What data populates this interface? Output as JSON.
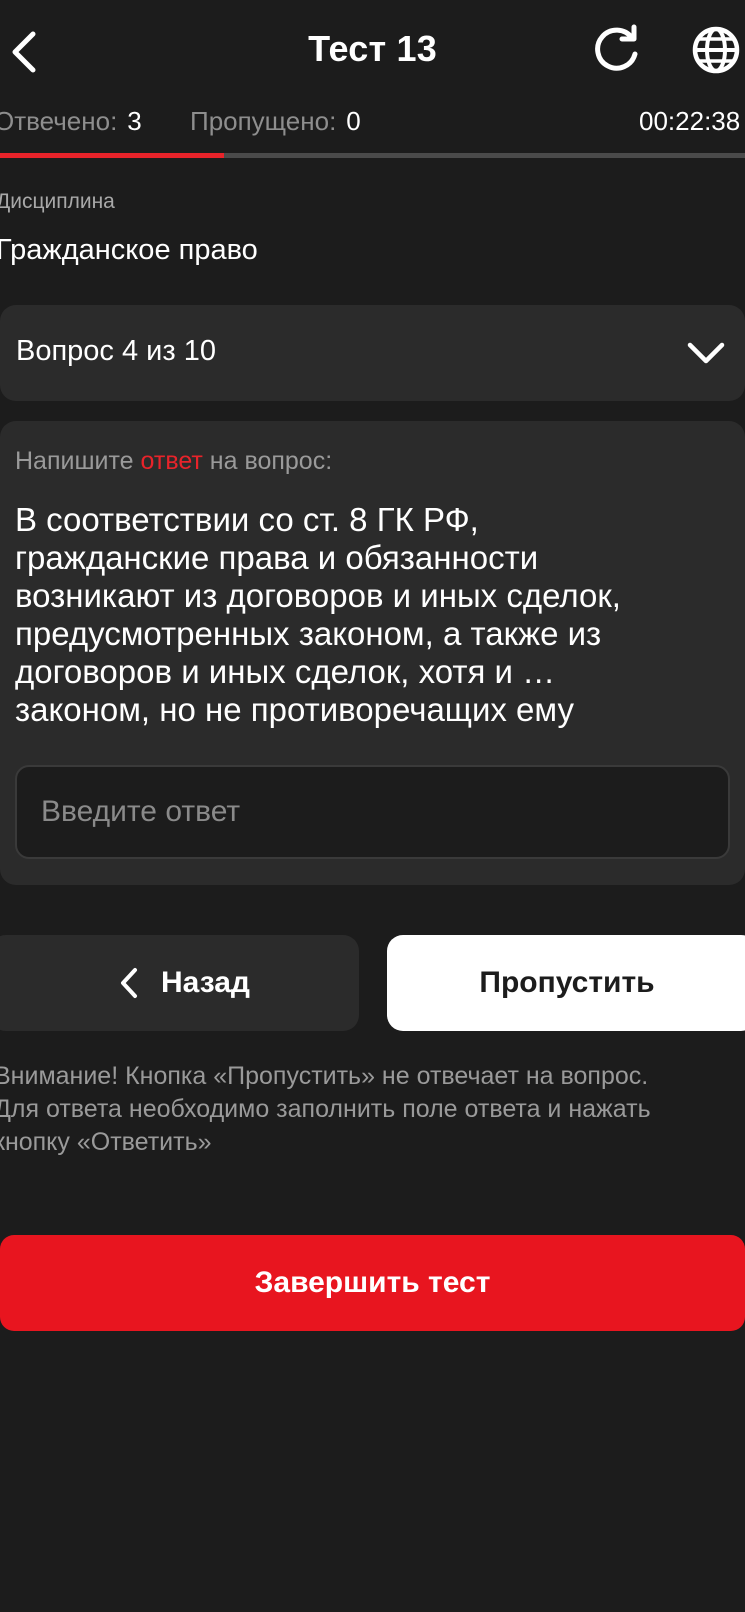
{
  "header": {
    "title": "Тест 13",
    "back_icon": "chevron-left-icon",
    "refresh_icon": "refresh-icon",
    "language_icon": "globe-icon"
  },
  "status": {
    "answered_label": "Отвечено:",
    "answered_value": "3",
    "skipped_label": "Пропущено:",
    "skipped_value": "0",
    "timer": "00:22:38",
    "progress_fraction": 0.3
  },
  "discipline": {
    "label": "Дисциплина",
    "value": "Гражданское право"
  },
  "question_selector": {
    "label": "Вопрос 4 из 10",
    "icon": "chevron-down-icon"
  },
  "question": {
    "instruction_before": "Напишите ",
    "instruction_accent": "ответ",
    "instruction_after": " на вопрос:",
    "lines": [
      "В соответствии со ст. 8 ГК РФ,",
      "гражданские права и обязанности",
      "возникают из договоров и иных сделок,",
      "предусмотренных законом, а также из",
      "договоров и иных сделок, хотя и …",
      "законом, но не противоречащих ему"
    ],
    "answer_placeholder": "Введите ответ",
    "answer_value": ""
  },
  "actions": {
    "back_label": "Назад",
    "skip_label": "Пропустить",
    "finish_label": "Завершить тест"
  },
  "warning": {
    "lines": [
      "Внимание! Кнопка «Пропустить» не отвечает на вопрос.",
      "Для ответа необходимо заполнить поле ответа и нажать",
      "кнопку «Ответить»"
    ]
  },
  "colors": {
    "background": "#1c1c1c",
    "card": "#2b2b2b",
    "accent": "#e8232a",
    "finish": "#e8151f"
  }
}
